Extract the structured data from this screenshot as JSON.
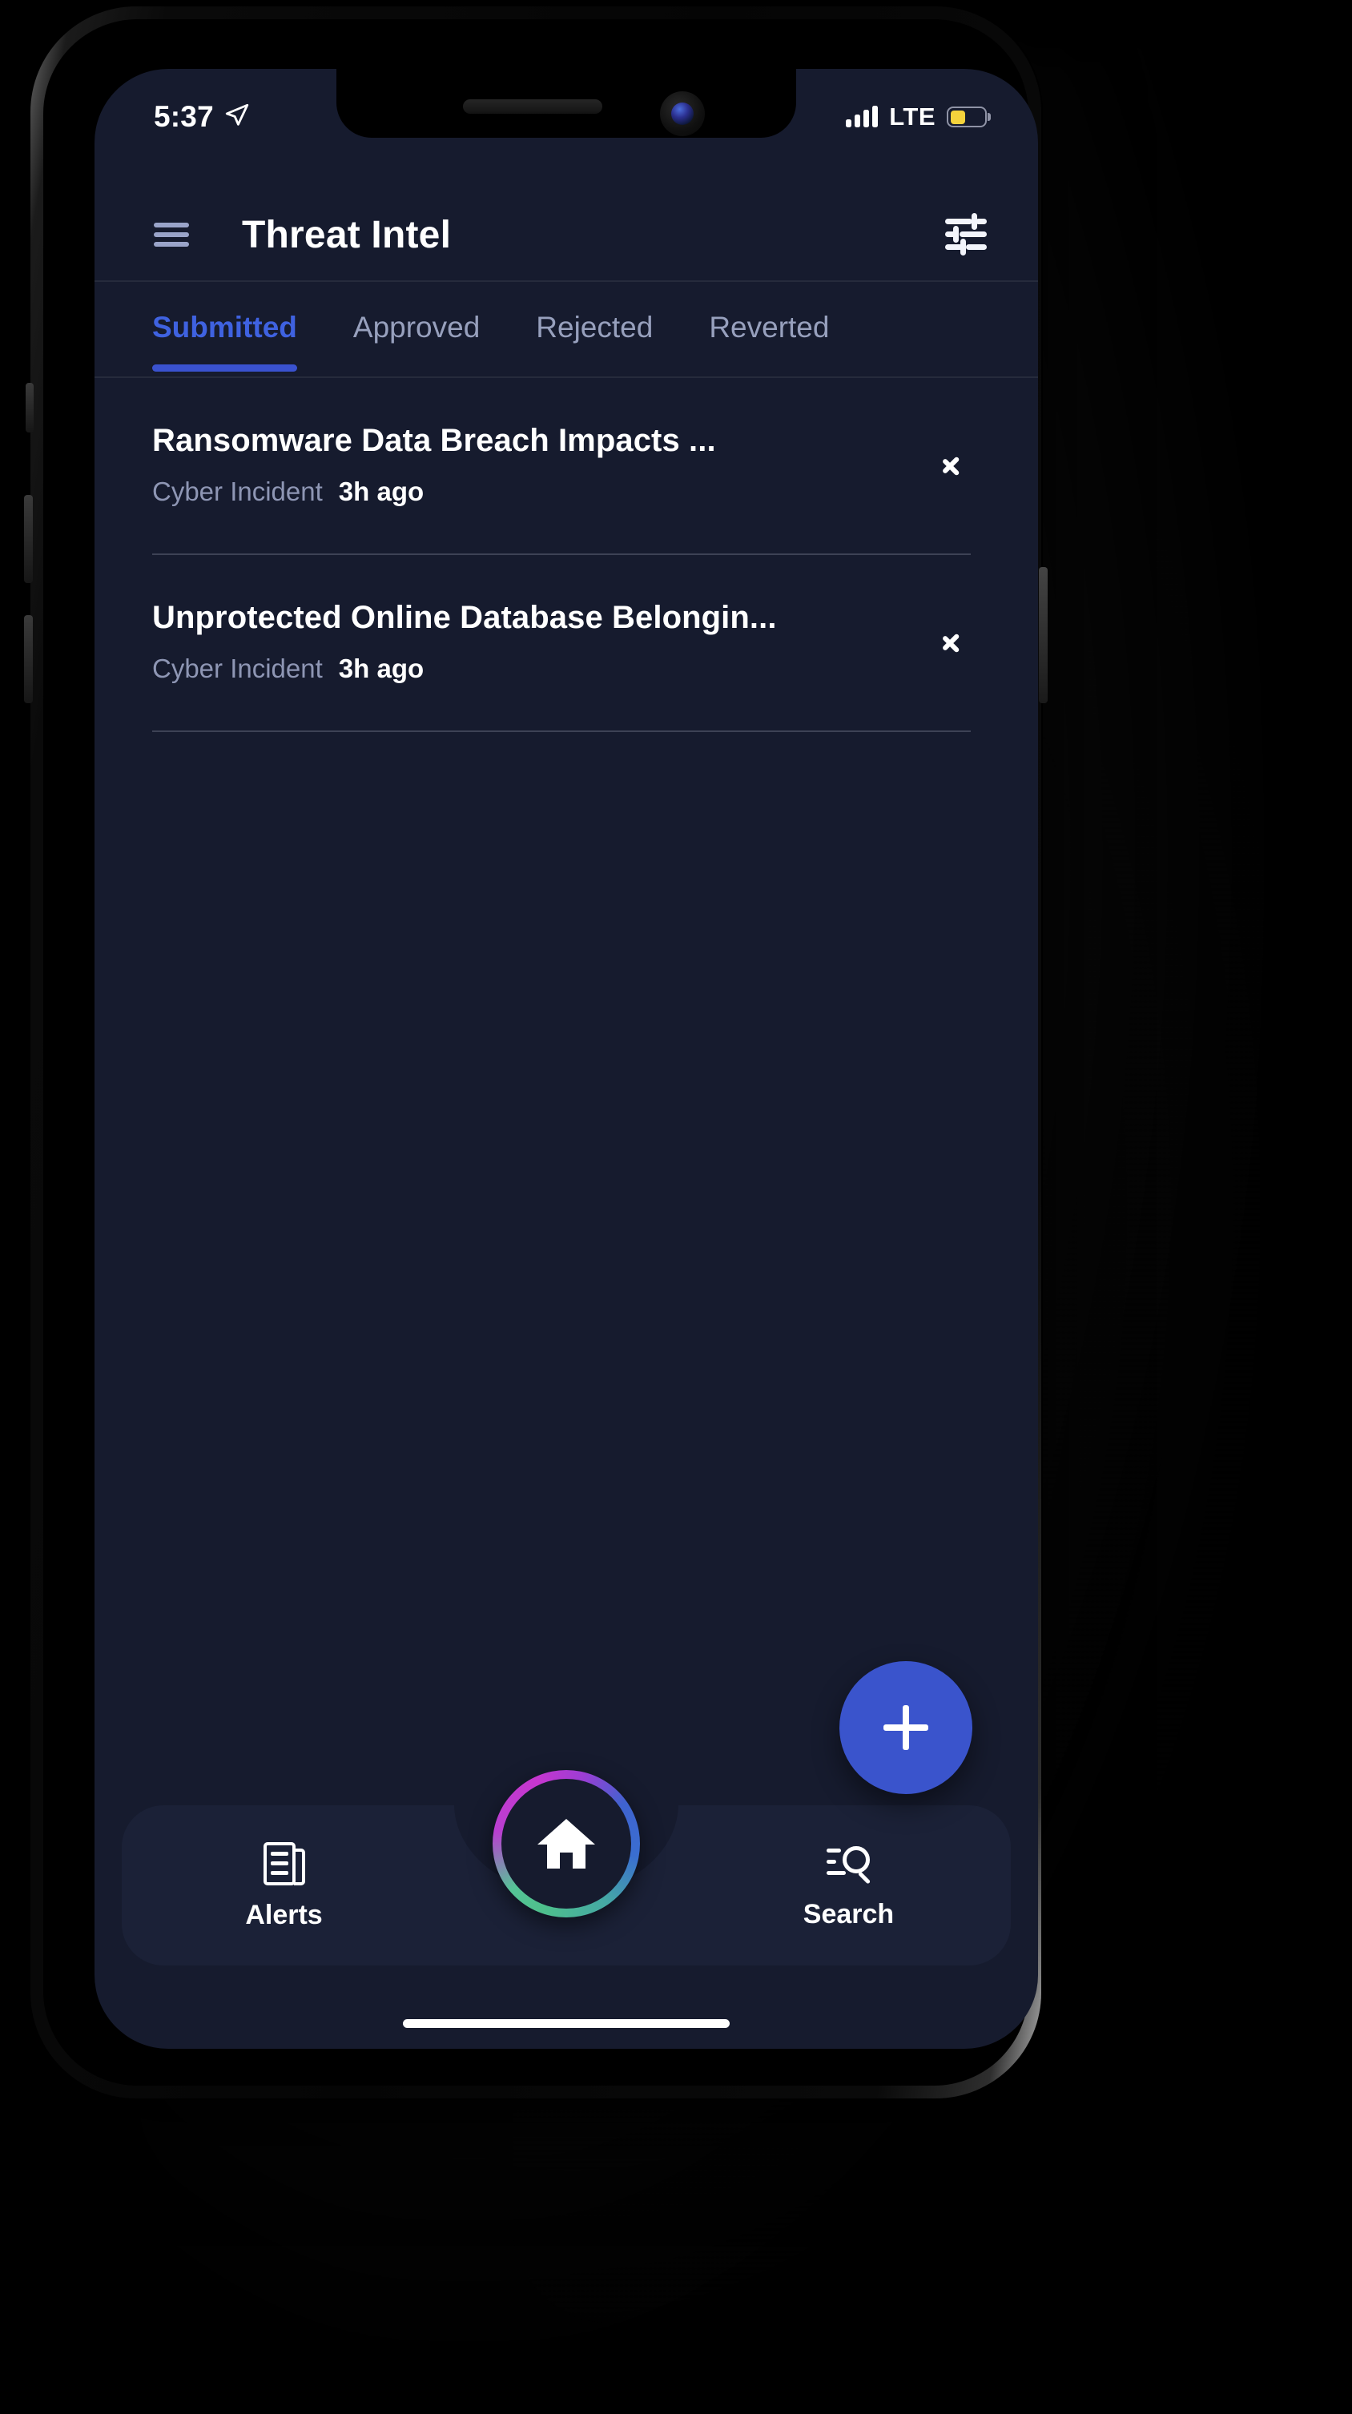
{
  "status_bar": {
    "time": "5:37",
    "location_icon": "location-arrow-icon",
    "signal_icon": "cellular-bars-icon",
    "carrier": "LTE",
    "battery_icon": "battery-low-power-icon",
    "battery_color": "#F5D33C"
  },
  "header": {
    "menu_icon": "hamburger-menu-icon",
    "title": "Threat Intel",
    "filter_icon": "tune-sliders-icon"
  },
  "tabs": [
    {
      "label": "Submitted",
      "active": true
    },
    {
      "label": "Approved",
      "active": false
    },
    {
      "label": "Rejected",
      "active": false
    },
    {
      "label": "Reverted",
      "active": false
    }
  ],
  "list": [
    {
      "title": "Ransomware Data Breach Impacts ...",
      "category": "Cyber Incident",
      "time": "3h ago",
      "chevron_icon": "chevron-right-icon"
    },
    {
      "title": "Unprotected Online Database Belongin...",
      "category": "Cyber Incident",
      "time": "3h ago",
      "chevron_icon": "chevron-right-icon"
    }
  ],
  "fab": {
    "icon": "plus-icon",
    "color": "#3A54CC"
  },
  "bottom_nav": {
    "items": [
      {
        "label": "Alerts",
        "icon": "newspaper-icon"
      },
      {
        "label": "Search",
        "icon": "search-list-icon"
      }
    ],
    "home": {
      "icon": "home-icon",
      "ring_colors": [
        "#4EC08C",
        "#C736CF",
        "#3F63CF"
      ]
    }
  },
  "theme": {
    "screen_bg": "#161B2E",
    "nav_bg": "#1B2137",
    "accent": "#3A52CF",
    "muted_text": "#8E96B4",
    "tab_inactive": "#97A0BD"
  }
}
